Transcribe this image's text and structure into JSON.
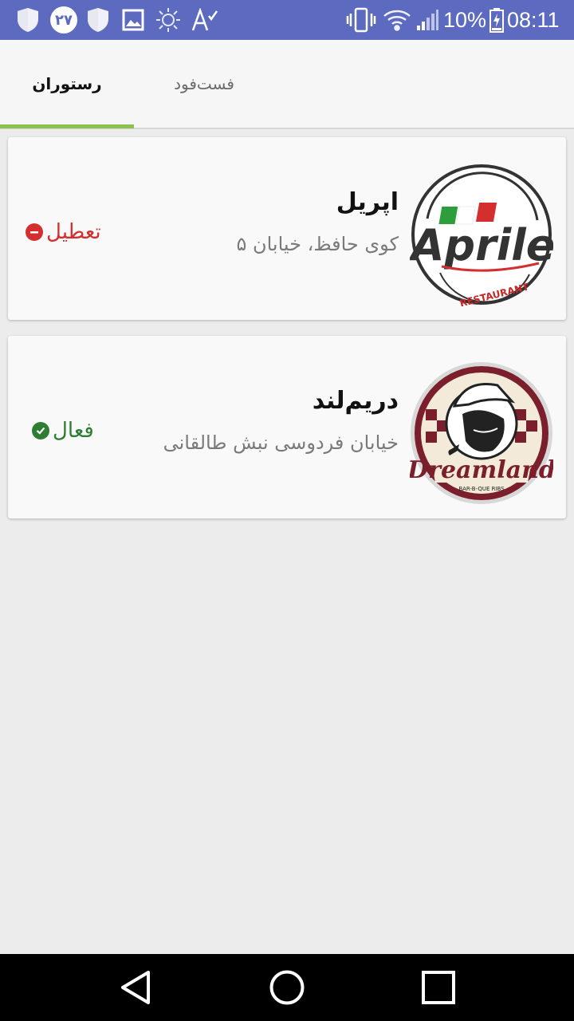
{
  "status_bar": {
    "notification_badge": "۲۷",
    "battery": "10%",
    "time": "08:11",
    "background": "#5c6bc0",
    "icons": [
      "shield-icon",
      "calendar-badge-icon",
      "shield-icon",
      "image-icon",
      "brightness-icon",
      "font-check-icon",
      "vibrate-icon",
      "wifi-icon",
      "signal-icon",
      "battery-icon"
    ]
  },
  "tabs": [
    {
      "label": "رستوران",
      "active": true
    },
    {
      "label": "فست‌فود",
      "active": false
    }
  ],
  "accent_color": "#8bc34a",
  "restaurants": [
    {
      "name": "اپریل",
      "address": "کوی حافظ، خیابان ۵",
      "status": "تعطیل",
      "status_color": "#d32f2f",
      "logo": {
        "wordmark": "Aprile",
        "subtitle": "RESTAURANT"
      }
    },
    {
      "name": "دریم‌لند",
      "address": "خیابان فردوسی نبش طالقانی",
      "status": "فعال",
      "status_color": "#2e7d32",
      "logo": {
        "wordmark": "Dreamland",
        "subtitle": "BAR-B-QUE RIBS"
      }
    }
  ],
  "nav_bar": {
    "icons": [
      "back-icon",
      "home-icon",
      "recents-icon"
    ]
  }
}
